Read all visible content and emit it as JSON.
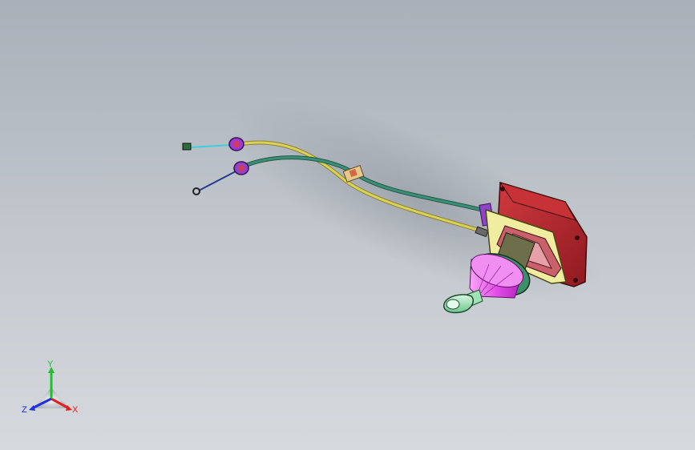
{
  "viewport": {
    "background_top": "#a9b0b9",
    "background_bottom": "#d6d9de"
  },
  "model": {
    "parts": [
      {
        "name": "shifter-housing",
        "color": "#b8232b"
      },
      {
        "name": "mounting-plate",
        "color": "#f0eda0"
      },
      {
        "name": "shift-boot",
        "color": "#e24fe6"
      },
      {
        "name": "shift-knob",
        "color": "#9fe3b6"
      },
      {
        "name": "select-cable",
        "color": "#cfc64a"
      },
      {
        "name": "shift-cable",
        "color": "#2f7a63"
      },
      {
        "name": "cable-bracket",
        "color": "#8e44c9"
      }
    ]
  },
  "triad": {
    "x_label": "X",
    "y_label": "Y",
    "z_label": "Z",
    "x_color": "#e02020",
    "y_color": "#1fbf2f",
    "z_color": "#2030e0"
  }
}
